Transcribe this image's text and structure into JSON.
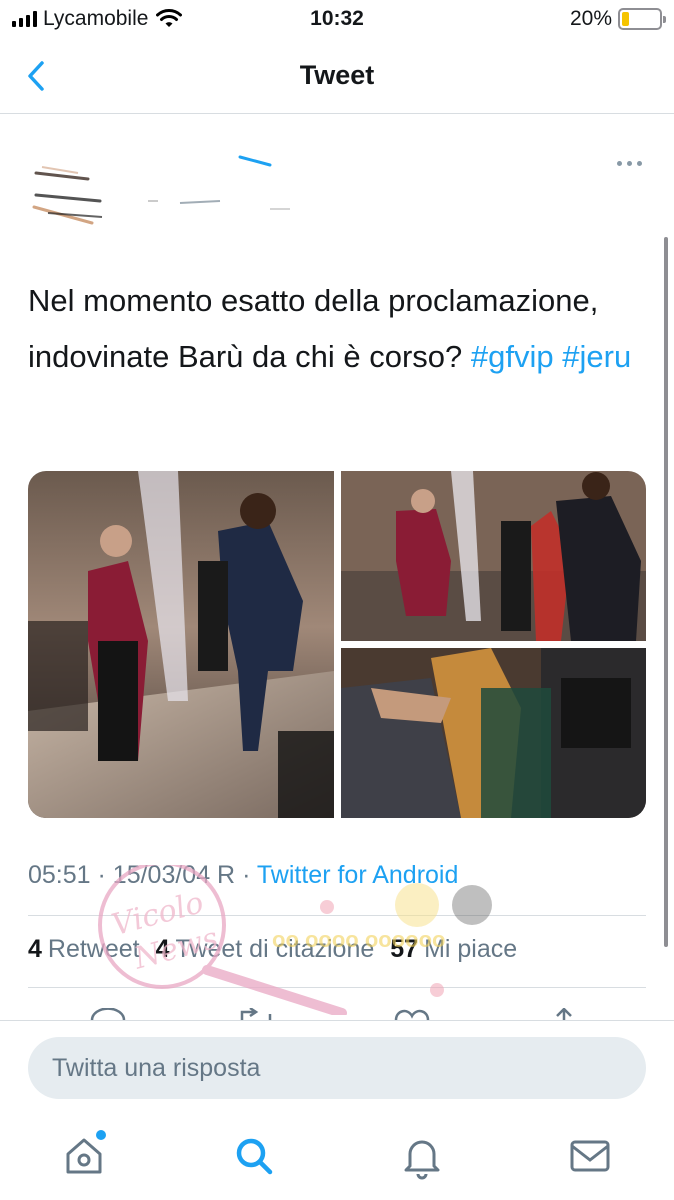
{
  "status_bar": {
    "carrier": "Lycamobile",
    "time": "10:32",
    "battery_percent": "20%",
    "battery_level": 0.2,
    "battery_color": "#f5c400"
  },
  "nav": {
    "title": "Tweet",
    "back_icon": "chevron-left-icon"
  },
  "tweet": {
    "author_obscured": true,
    "text": "Nel momento esatto della proclamazione, indovinate Barù da chi è corso?",
    "hashtags": [
      "#gfvip",
      "#jeru"
    ],
    "photos_count": 3,
    "time": "05:51",
    "date": "15/03/04 R",
    "separator": "·",
    "source": "Twitter for Android",
    "stats": {
      "retweets_count": "4",
      "retweets_label": "Retweet",
      "quotes_count": "4",
      "quotes_label": "Tweet di citazione",
      "likes_count": "57",
      "likes_label": "Mi piace"
    }
  },
  "watermark": {
    "text": "Vicolo delle News"
  },
  "reply": {
    "placeholder": "Twitta una risposta"
  },
  "tabs": [
    {
      "icon": "home-icon",
      "active": false,
      "badge": true
    },
    {
      "icon": "search-icon",
      "active": true
    },
    {
      "icon": "bell-icon",
      "active": false
    },
    {
      "icon": "mail-icon",
      "active": false
    }
  ],
  "colors": {
    "accent": "#1da1f2",
    "text_primary": "#14171a",
    "text_secondary": "#657786",
    "divider": "#d8dde1"
  }
}
